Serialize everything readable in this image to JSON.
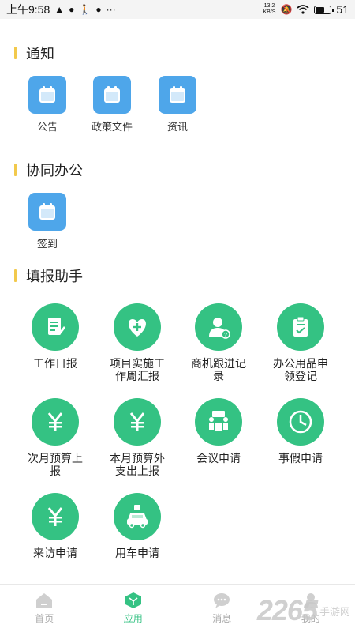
{
  "status_bar": {
    "time": "上午9:58",
    "net_speed_value": "13.2",
    "net_speed_unit": "KB/S",
    "battery_level": "51",
    "battery_fraction": 0.51
  },
  "sections": {
    "notice_title": "通知",
    "collab_title": "协同办公",
    "helper_title": "填报助手"
  },
  "notice_items": [
    {
      "label": "公告",
      "icon": "calendar-icon"
    },
    {
      "label": "政策文件",
      "icon": "calendar-icon"
    },
    {
      "label": "资讯",
      "icon": "calendar-icon"
    }
  ],
  "collab_items": [
    {
      "label": "签到",
      "icon": "calendar-icon"
    }
  ],
  "helper_items": [
    {
      "label": "工作日报",
      "icon": "document-edit-icon"
    },
    {
      "label": "项目实施工作周汇报",
      "icon": "heart-plus-icon"
    },
    {
      "label": "商机跟进记录",
      "icon": "person-question-icon"
    },
    {
      "label": "办公用品申领登记",
      "icon": "clipboard-check-icon"
    },
    {
      "label": "次月预算上报",
      "icon": "yen-icon"
    },
    {
      "label": "本月预算外支出上报",
      "icon": "yen-icon"
    },
    {
      "label": "会议申请",
      "icon": "meeting-icon"
    },
    {
      "label": "事假申请",
      "icon": "clock-icon"
    },
    {
      "label": "来访申请",
      "icon": "yen-icon"
    },
    {
      "label": "用车申请",
      "icon": "car-icon"
    }
  ],
  "tab_bar": {
    "home": "首页",
    "apps": "应用",
    "messages": "消息",
    "mine": "我的",
    "active": "apps"
  },
  "watermark": {
    "number": "2265",
    "text": "手游网"
  },
  "colors": {
    "notice_icon_bg": "#4ea6ea",
    "helper_icon_bg": "#34c283",
    "section_bar": "#f2c94c",
    "tab_active": "#34c283"
  }
}
